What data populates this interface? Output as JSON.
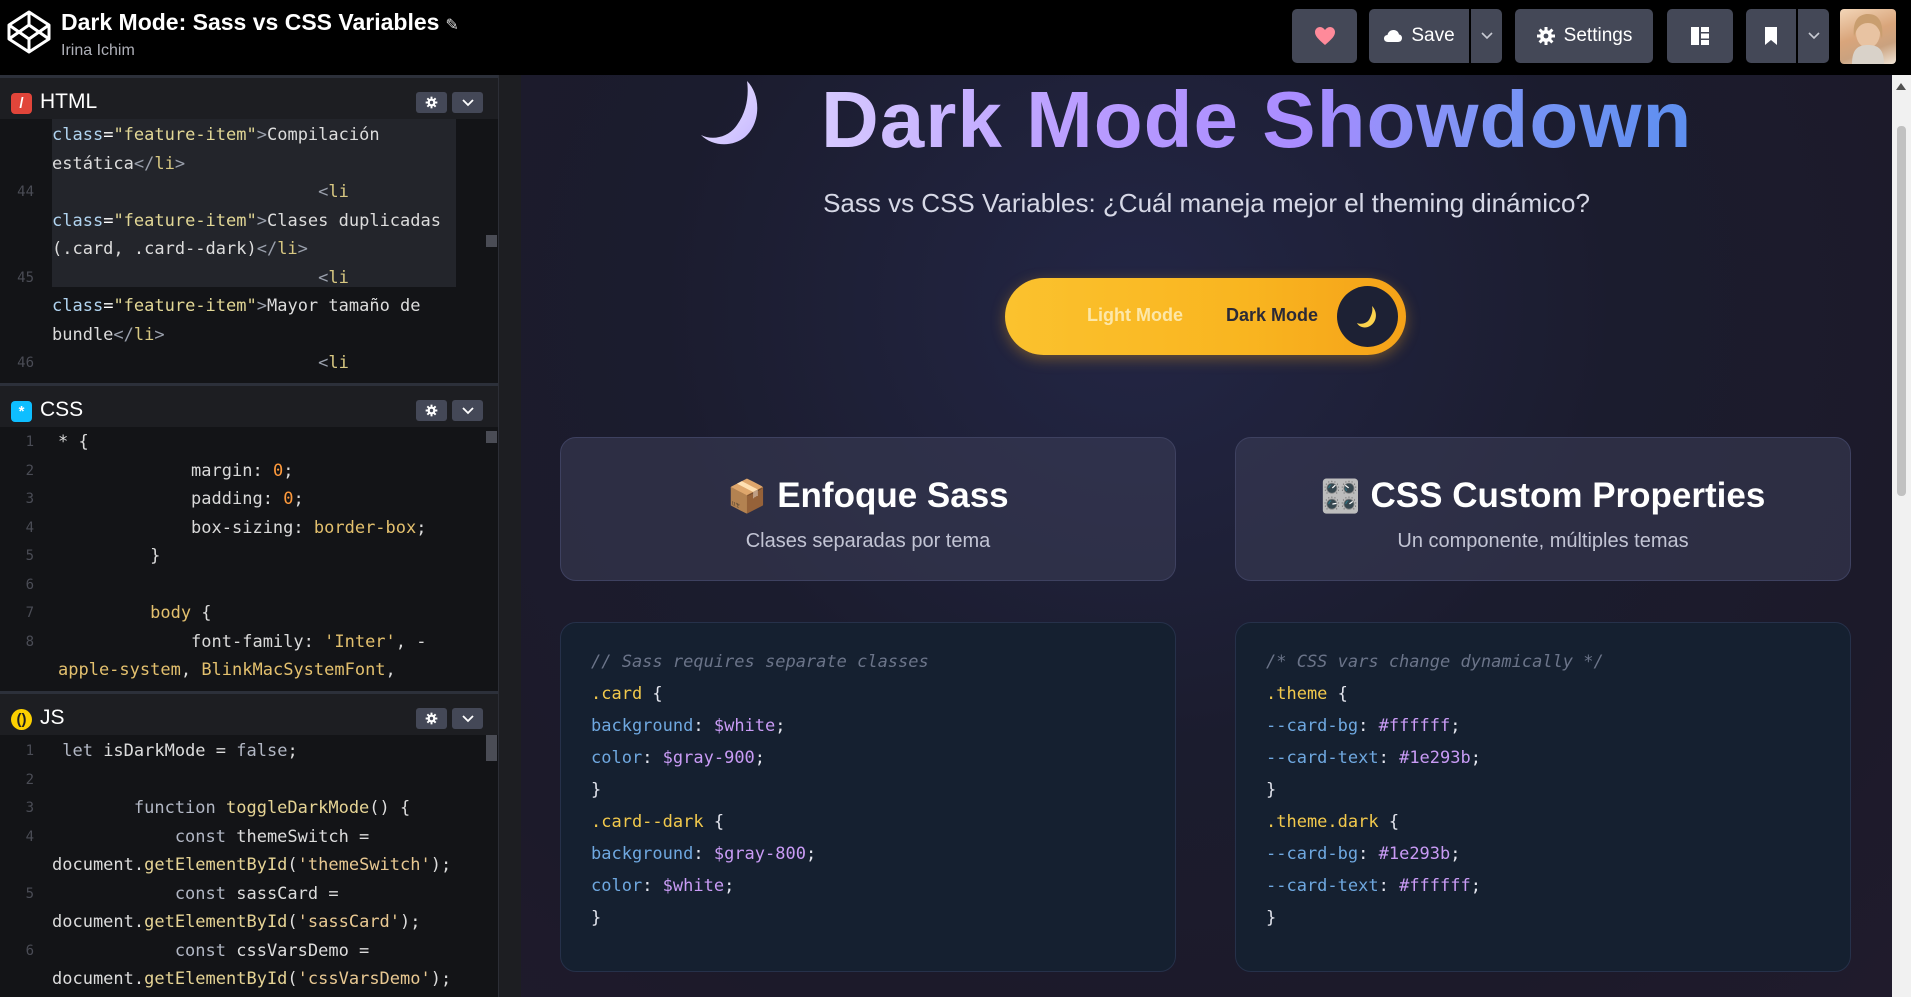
{
  "header": {
    "title": "Dark Mode: Sass vs CSS Variables",
    "author": "Irina Ichim",
    "save_label": "Save",
    "settings_label": "Settings"
  },
  "editors": {
    "html": {
      "label": "HTML",
      "lines": [
        {
          "n": "",
          "parts": [
            [
              "c-attr",
              "class"
            ],
            [
              "c-eq",
              "="
            ],
            [
              "c-str2",
              "\"feature-item\""
            ],
            [
              "c-tag",
              ">"
            ],
            [
              "c-js",
              "Compilación"
            ]
          ]
        },
        {
          "n": "",
          "parts": [
            [
              "c-js",
              "estática"
            ],
            [
              "c-tag",
              "</"
            ],
            [
              "c-tagn",
              "li"
            ],
            [
              "c-tag",
              ">"
            ]
          ]
        },
        {
          "n": "44",
          "parts": [
            [
              "c-tag",
              "                          <"
            ],
            [
              "c-tagn",
              "li"
            ]
          ]
        },
        {
          "n": "",
          "parts": [
            [
              "c-attr",
              "class"
            ],
            [
              "c-eq",
              "="
            ],
            [
              "c-str2",
              "\"feature-item\""
            ],
            [
              "c-tag",
              ">"
            ],
            [
              "c-js",
              "Clases duplicadas"
            ]
          ]
        },
        {
          "n": "",
          "parts": [
            [
              "c-js",
              "(.card, .card--dark)"
            ],
            [
              "c-tag",
              "</"
            ],
            [
              "c-tagn",
              "li"
            ],
            [
              "c-tag",
              ">"
            ]
          ]
        },
        {
          "n": "45",
          "parts": [
            [
              "c-tag",
              "                          <"
            ],
            [
              "c-tagn",
              "li"
            ]
          ]
        },
        {
          "n": "",
          "parts": [
            [
              "c-attr",
              "class"
            ],
            [
              "c-eq",
              "="
            ],
            [
              "c-str2",
              "\"feature-item\""
            ],
            [
              "c-tag",
              ">"
            ],
            [
              "c-js",
              "Mayor tamaño de"
            ]
          ]
        },
        {
          "n": "",
          "parts": [
            [
              "c-js",
              "bundle"
            ],
            [
              "c-tag",
              "</"
            ],
            [
              "c-tagn",
              "li"
            ],
            [
              "c-tag",
              ">"
            ]
          ]
        },
        {
          "n": "46",
          "parts": [
            [
              "c-tag",
              "                          <"
            ],
            [
              "c-tagn",
              "li"
            ]
          ]
        }
      ]
    },
    "css": {
      "label": "CSS",
      "lines": [
        {
          "n": "1",
          "parts": [
            [
              "c-js",
              "* {"
            ]
          ]
        },
        {
          "n": "2",
          "parts": [
            [
              "c-prop",
              "             margin"
            ],
            [
              "c-js",
              ": "
            ],
            [
              "c-num",
              "0"
            ],
            [
              "c-js",
              ";"
            ]
          ]
        },
        {
          "n": "3",
          "parts": [
            [
              "c-prop",
              "             padding"
            ],
            [
              "c-js",
              ": "
            ],
            [
              "c-num",
              "0"
            ],
            [
              "c-js",
              ";"
            ]
          ]
        },
        {
          "n": "4",
          "parts": [
            [
              "c-prop",
              "             box-sizing"
            ],
            [
              "c-js",
              ": "
            ],
            [
              "c-val",
              "border-box"
            ],
            [
              "c-js",
              ";"
            ]
          ]
        },
        {
          "n": "5",
          "parts": [
            [
              "c-js",
              "         }"
            ]
          ]
        },
        {
          "n": "6",
          "parts": [
            [
              "c-js",
              ""
            ]
          ]
        },
        {
          "n": "7",
          "parts": [
            [
              "c-sel",
              "         body"
            ],
            [
              "c-js",
              " {"
            ]
          ]
        },
        {
          "n": "8",
          "parts": [
            [
              "c-prop",
              "             font-family"
            ],
            [
              "c-js",
              ": "
            ],
            [
              "c-val",
              "'Inter'"
            ],
            [
              "c-js",
              ", -"
            ]
          ]
        },
        {
          "n": "",
          "parts": [
            [
              "c-val",
              "apple-system"
            ],
            [
              "c-js",
              ", "
            ],
            [
              "c-val",
              "BlinkMacSystemFont"
            ],
            [
              "c-js",
              ","
            ]
          ]
        }
      ]
    },
    "js": {
      "label": "JS",
      "lines": [
        {
          "n": "1",
          "parts": [
            [
              "c-kw",
              " let "
            ],
            [
              "c-js",
              "isDarkMode = "
            ],
            [
              "c-kw",
              "false"
            ],
            [
              "c-js",
              ";"
            ]
          ]
        },
        {
          "n": "2",
          "parts": [
            [
              "c-js",
              ""
            ]
          ]
        },
        {
          "n": "3",
          "parts": [
            [
              "c-kw",
              "        function "
            ],
            [
              "c-fn",
              "toggleDarkMode"
            ],
            [
              "c-js",
              "() {"
            ]
          ]
        },
        {
          "n": "4",
          "parts": [
            [
              "c-kw",
              "            const "
            ],
            [
              "c-js",
              "themeSwitch ="
            ]
          ]
        },
        {
          "n": "",
          "parts": [
            [
              "c-js",
              "document."
            ],
            [
              "c-fn",
              "getElementById"
            ],
            [
              "c-js",
              "("
            ],
            [
              "c-jsstr",
              "'themeSwitch'"
            ],
            [
              "c-js",
              ");"
            ]
          ]
        },
        {
          "n": "5",
          "parts": [
            [
              "c-kw",
              "            const "
            ],
            [
              "c-js",
              "sassCard ="
            ]
          ]
        },
        {
          "n": "",
          "parts": [
            [
              "c-js",
              "document."
            ],
            [
              "c-fn",
              "getElementById"
            ],
            [
              "c-js",
              "("
            ],
            [
              "c-jsstr",
              "'sassCard'"
            ],
            [
              "c-js",
              ");"
            ]
          ]
        },
        {
          "n": "6",
          "parts": [
            [
              "c-kw",
              "            const "
            ],
            [
              "c-js",
              "cssVarsDemo ="
            ]
          ]
        },
        {
          "n": "",
          "parts": [
            [
              "c-js",
              "document."
            ],
            [
              "c-fn",
              "getElementById"
            ],
            [
              "c-js",
              "("
            ],
            [
              "c-jsstr",
              "'cssVarsDemo'"
            ],
            [
              "c-js",
              ");"
            ]
          ]
        }
      ]
    }
  },
  "preview": {
    "heading": "Dark Mode Showdown",
    "subtitle": "Sass vs CSS Variables: ¿Cuál maneja mejor el theming dinámico?",
    "toggle": {
      "light": "Light Mode",
      "dark": "Dark Mode"
    },
    "cards": [
      {
        "emoji": "📦",
        "title": "Enfoque Sass",
        "subtitle": "Clases separadas por tema"
      },
      {
        "emoji": "🎛️",
        "title": "CSS Custom Properties",
        "subtitle": "Un componente, múltiples temas"
      }
    ],
    "code_left": [
      [
        [
          "k-cmt",
          "// Sass requires separate classes"
        ]
      ],
      [
        [
          "k-sel",
          ".card"
        ],
        [
          "k-br",
          " {"
        ]
      ],
      [
        [
          "k-prop",
          "background"
        ],
        [
          "k-punc",
          ": "
        ],
        [
          "k-var",
          "$white"
        ],
        [
          "k-punc",
          ";"
        ]
      ],
      [
        [
          "k-prop",
          "color"
        ],
        [
          "k-punc",
          ": "
        ],
        [
          "k-var",
          "$gray-900"
        ],
        [
          "k-punc",
          ";"
        ]
      ],
      [
        [
          "k-br",
          "}"
        ]
      ],
      [
        [
          "k-sel",
          ".card--dark"
        ],
        [
          "k-br",
          " {"
        ]
      ],
      [
        [
          "k-prop",
          "background"
        ],
        [
          "k-punc",
          ": "
        ],
        [
          "k-var",
          "$gray-800"
        ],
        [
          "k-punc",
          ";"
        ]
      ],
      [
        [
          "k-prop",
          "color"
        ],
        [
          "k-punc",
          ": "
        ],
        [
          "k-var",
          "$white"
        ],
        [
          "k-punc",
          ";"
        ]
      ],
      [
        [
          "k-br",
          "}"
        ]
      ]
    ],
    "code_right": [
      [
        [
          "k-cmt",
          "/* CSS vars change dynamically */"
        ]
      ],
      [
        [
          "k-sel",
          ".theme"
        ],
        [
          "k-br",
          " {"
        ]
      ],
      [
        [
          "k-prop",
          "--card-bg"
        ],
        [
          "k-punc",
          ": "
        ],
        [
          "k-hex",
          "#ffffff"
        ],
        [
          "k-punc",
          ";"
        ]
      ],
      [
        [
          "k-prop",
          "--card-text"
        ],
        [
          "k-punc",
          ": "
        ],
        [
          "k-hex",
          "#1e293b"
        ],
        [
          "k-punc",
          ";"
        ]
      ],
      [
        [
          "k-br",
          "}"
        ]
      ],
      [
        [
          "k-sel",
          ".theme.dark"
        ],
        [
          "k-br",
          " {"
        ]
      ],
      [
        [
          "k-prop",
          "--card-bg"
        ],
        [
          "k-punc",
          ": "
        ],
        [
          "k-hex",
          "#1e293b"
        ],
        [
          "k-punc",
          ";"
        ]
      ],
      [
        [
          "k-prop",
          "--card-text"
        ],
        [
          "k-punc",
          ": "
        ],
        [
          "k-hex",
          "#ffffff"
        ],
        [
          "k-punc",
          ";"
        ]
      ],
      [
        [
          "k-br",
          "}"
        ]
      ]
    ]
  },
  "colors": {
    "accent_heart": "#ff8a9a",
    "toggle_gold": "#fbc22e",
    "heading_gradient_start": "#d6c9ff",
    "heading_gradient_end": "#5d8ff0"
  }
}
